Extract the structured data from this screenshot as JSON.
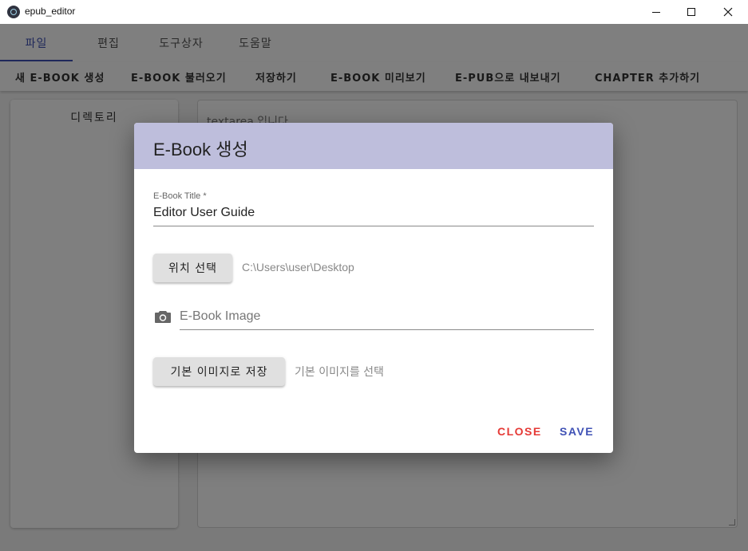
{
  "window": {
    "title": "epub_editor"
  },
  "menu": {
    "tabs": [
      {
        "label": "파일"
      },
      {
        "label": "편집"
      },
      {
        "label": "도구상자"
      },
      {
        "label": "도움말"
      }
    ]
  },
  "toolbar": {
    "items": [
      {
        "label": "새 E-BOOK 생성"
      },
      {
        "label": "E-BOOK 불러오기"
      },
      {
        "label": "저장하기"
      },
      {
        "label": "E-BOOK 미리보기"
      },
      {
        "label": "E-PUB으로 내보내기"
      },
      {
        "label": "CHAPTER 추가하기"
      }
    ]
  },
  "sidebar": {
    "title": "디렉토리"
  },
  "editor": {
    "text": "textarea 입니다"
  },
  "dialog": {
    "title": "E-Book 생성",
    "title_field": {
      "label": "E-Book Title *",
      "value": "Editor User Guide"
    },
    "location_button": "위치 선택",
    "location_path": "C:\\Users\\user\\Desktop",
    "image_field": {
      "placeholder": "E-Book Image",
      "icon": "camera-icon"
    },
    "default_image_button": "기본 이미지로 저장",
    "default_image_note": "기본 이미지를 선택",
    "close_label": "CLOSE",
    "save_label": "SAVE"
  },
  "colors": {
    "accent": "#3f51b5",
    "dialog_header": "#bebedc",
    "close": "#e53935"
  }
}
